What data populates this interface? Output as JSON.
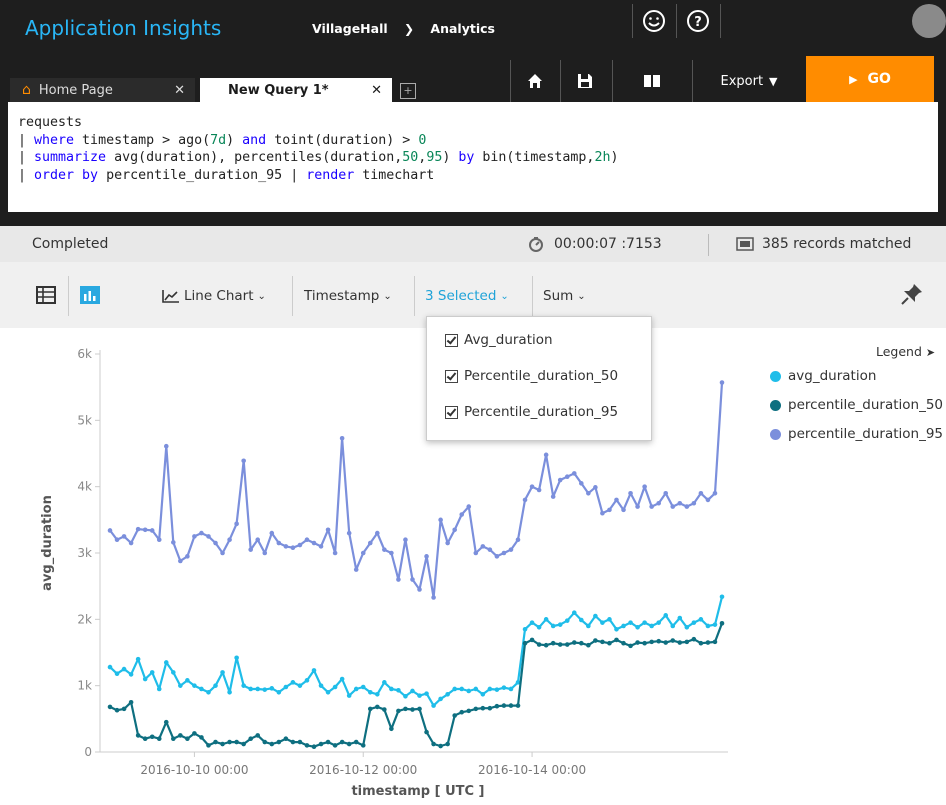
{
  "header": {
    "app_title": "Application Insights",
    "breadcrumb": [
      "VillageHall",
      "Analytics"
    ]
  },
  "tabs": [
    {
      "label": "Home Page",
      "active": false
    },
    {
      "label": "New Query 1*",
      "active": true
    }
  ],
  "toolbar_top": {
    "export_label": "Export",
    "go_label": "GO"
  },
  "query": {
    "lines": [
      "requests",
      "| where timestamp > ago(7d) and toint(duration) > 0",
      "| summarize avg(duration), percentiles(duration,50,95) by bin(timestamp,2h)",
      "| order by percentile_duration_95 | render timechart"
    ]
  },
  "status": {
    "state": "Completed",
    "elapsed": "00:00:07 :7153",
    "records": "385 records matched"
  },
  "chart_toolbar": {
    "chart_type": "Line Chart",
    "x_column": "Timestamp",
    "series_selected": "3 Selected",
    "aggregation": "Sum"
  },
  "dropdown": {
    "items": [
      "Avg_duration",
      "Percentile_duration_50",
      "Percentile_duration_95"
    ]
  },
  "legend": {
    "title": "Legend"
  },
  "colors": {
    "avg_duration": "#1fbde9",
    "percentile_duration_50": "#0e6f80",
    "percentile_duration_95": "#7b8fdc",
    "go_button": "#ff8c00",
    "app_title": "#29b6f6"
  },
  "chart_data": {
    "type": "line",
    "xlabel": "timestamp [ UTC ]",
    "ylabel": "avg_duration",
    "ylim": [
      0,
      6000
    ],
    "y_ticks": [
      "0",
      "1k",
      "2k",
      "3k",
      "4k",
      "5k",
      "6k"
    ],
    "x_ticks": [
      "2016-10-10 00:00",
      "2016-10-12 00:00",
      "2016-10-14 00:00"
    ],
    "x_start": "2016-10-09 00:00",
    "x_step_hours": 2,
    "legend_position": "right",
    "series": [
      {
        "name": "avg_duration",
        "values": [
          1280,
          1180,
          1250,
          1170,
          1400,
          1100,
          1200,
          950,
          1350,
          1200,
          1000,
          1080,
          1000,
          950,
          900,
          1000,
          1200,
          900,
          1420,
          1000,
          950,
          950,
          940,
          960,
          900,
          980,
          1050,
          1000,
          1080,
          1230,
          1000,
          900,
          980,
          1100,
          850,
          950,
          980,
          900,
          870,
          1050,
          950,
          930,
          840,
          920,
          850,
          880,
          700,
          800,
          870,
          950,
          950,
          920,
          950,
          870,
          950,
          940,
          970,
          950,
          1050,
          1850,
          1950,
          1880,
          2000,
          1900,
          1920,
          1980,
          2100,
          1990,
          1900,
          2050,
          1950,
          2000,
          1850,
          1900,
          1950,
          1880,
          1950,
          1900,
          1950,
          2060,
          1900,
          2020,
          1880,
          1950,
          2000,
          1900,
          1920,
          2340
        ]
      },
      {
        "name": "percentile_duration_50",
        "values": [
          680,
          630,
          650,
          750,
          250,
          200,
          230,
          200,
          450,
          200,
          250,
          200,
          280,
          220,
          100,
          150,
          120,
          150,
          150,
          120,
          200,
          250,
          150,
          120,
          150,
          200,
          150,
          150,
          100,
          80,
          120,
          150,
          100,
          150,
          120,
          150,
          100,
          650,
          680,
          640,
          350,
          620,
          650,
          640,
          650,
          300,
          120,
          90,
          120,
          550,
          600,
          620,
          650,
          660,
          660,
          690,
          700,
          700,
          700,
          1640,
          1690,
          1620,
          1610,
          1640,
          1620,
          1620,
          1650,
          1640,
          1610,
          1680,
          1660,
          1640,
          1690,
          1640,
          1600,
          1650,
          1640,
          1660,
          1670,
          1650,
          1680,
          1650,
          1660,
          1700,
          1640,
          1650,
          1660,
          1940
        ]
      },
      {
        "name": "percentile_duration_95",
        "values": [
          3340,
          3200,
          3250,
          3150,
          3360,
          3350,
          3340,
          3200,
          4610,
          3160,
          2880,
          2950,
          3250,
          3300,
          3250,
          3150,
          3000,
          3200,
          3440,
          4390,
          3050,
          3200,
          3000,
          3300,
          3150,
          3100,
          3080,
          3120,
          3200,
          3150,
          3100,
          3350,
          3000,
          4730,
          3300,
          2750,
          3000,
          3150,
          3300,
          3050,
          3000,
          2600,
          3200,
          2600,
          2450,
          2950,
          2330,
          3500,
          3150,
          3350,
          3580,
          3700,
          3000,
          3100,
          3050,
          2950,
          3000,
          3050,
          3200,
          3800,
          4000,
          3950,
          4480,
          3850,
          4100,
          4150,
          4200,
          4050,
          3900,
          3990,
          3600,
          3650,
          3800,
          3650,
          3900,
          3700,
          4000,
          3700,
          3750,
          3900,
          3700,
          3750,
          3700,
          3750,
          3900,
          3800,
          3900,
          5570
        ]
      }
    ]
  }
}
